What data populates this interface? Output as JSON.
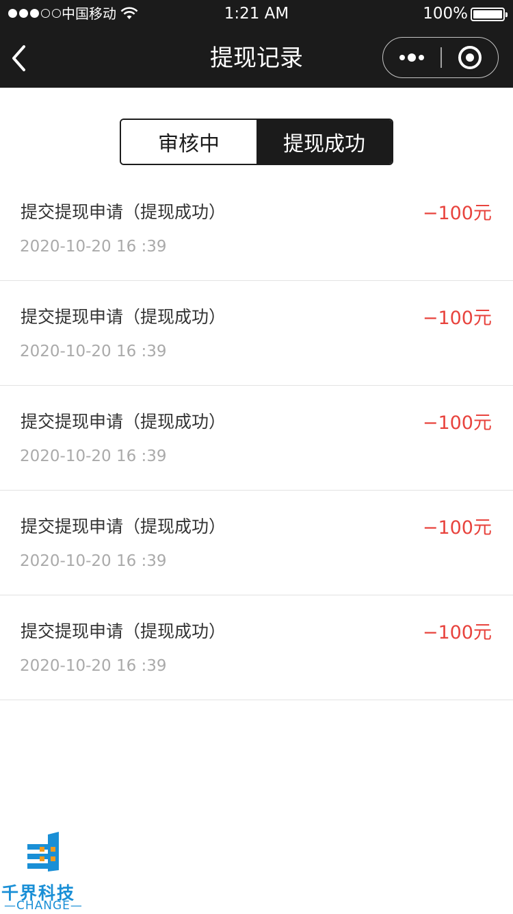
{
  "status_bar": {
    "carrier": "中国移动",
    "time": "1:21 AM",
    "battery": "100%",
    "battery_level": 1.0
  },
  "nav": {
    "title": "提现记录",
    "back_icon": "chevron-left-icon",
    "more_icon": "more-dots-icon",
    "close_icon": "target-close-icon"
  },
  "tabs": [
    {
      "label": "审核中",
      "active": false
    },
    {
      "label": "提现成功",
      "active": true
    }
  ],
  "records": [
    {
      "title": "提交提现申请（提现成功）",
      "time": "2020-10-20  16 :39",
      "amount": "−100元"
    },
    {
      "title": "提交提现申请（提现成功）",
      "time": "2020-10-20  16 :39",
      "amount": "−100元"
    },
    {
      "title": "提交提现申请（提现成功）",
      "time": "2020-10-20  16 :39",
      "amount": "−100元"
    },
    {
      "title": "提交提现申请（提现成功）",
      "time": "2020-10-20  16 :39",
      "amount": "−100元"
    },
    {
      "title": "提交提现申请（提现成功）",
      "time": "2020-10-20  16 :39",
      "amount": "−100元"
    }
  ],
  "watermark": {
    "name": "千界科技",
    "sub": "—CHANGE—"
  },
  "colors": {
    "bar": "#1b1b1b",
    "amount": "#e8433d",
    "time": "#aaaaaa",
    "watermark": "#1a8fd6"
  }
}
